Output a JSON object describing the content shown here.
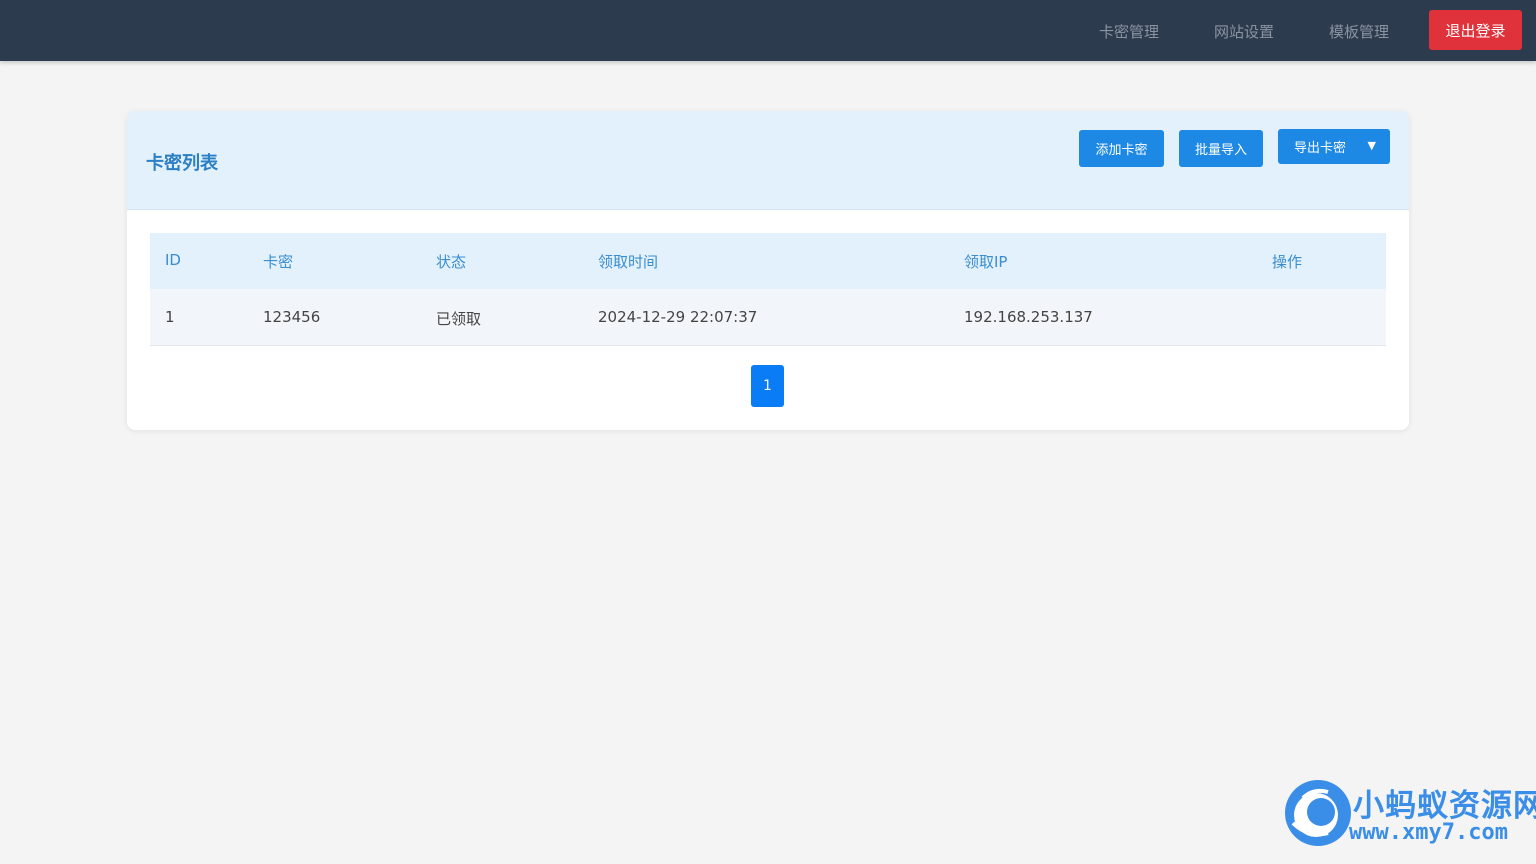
{
  "nav": {
    "items": [
      "卡密管理",
      "网站设置",
      "模板管理"
    ],
    "logout_label": "退出登录"
  },
  "card": {
    "title": "卡密列表",
    "buttons": {
      "add": "添加卡密",
      "import": "批量导入",
      "export": "导出卡密"
    }
  },
  "table": {
    "headers": [
      "ID",
      "卡密",
      "状态",
      "领取时间",
      "领取IP",
      "操作"
    ],
    "rows": [
      [
        "1",
        "123456",
        "已领取",
        "2024-12-29 22:07:37",
        "192.168.253.137",
        ""
      ]
    ]
  },
  "pagination": {
    "current": "1"
  },
  "watermark": {
    "name": "小蚂蚁资源网",
    "url": "www.xmy7.com"
  },
  "colors": {
    "topbar": "#2d3b4e",
    "accent": "#1e88e5",
    "danger": "#e0323a"
  }
}
